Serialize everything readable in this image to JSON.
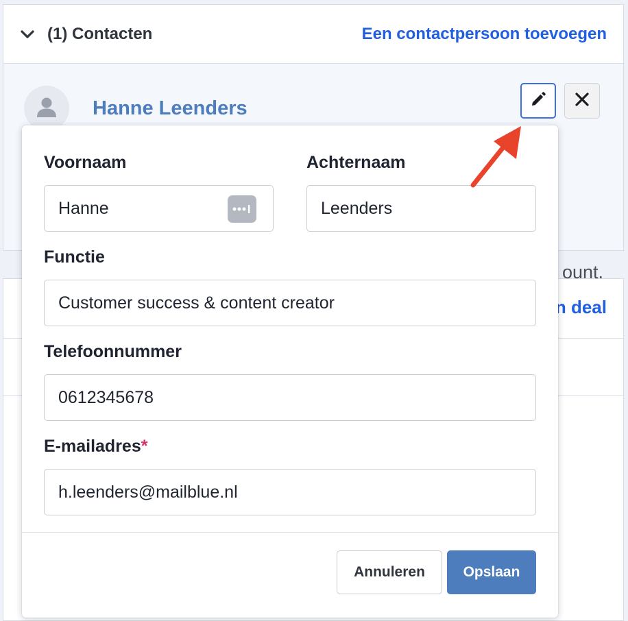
{
  "contacts_panel": {
    "title": "(1) Contacten",
    "add_link": "Een contactpersoon toevoegen",
    "icons": {
      "collapse": "chevron-down-icon",
      "avatar": "person-icon",
      "edit": "pencil-icon",
      "remove": "close-icon"
    }
  },
  "contact": {
    "name": "Hanne Leenders"
  },
  "deals_panel": {
    "add_link_partial": "n deal"
  },
  "background_text": "ount.",
  "edit_form": {
    "first_name": {
      "label": "Voornaam",
      "value": "Hanne"
    },
    "last_name": {
      "label": "Achternaam",
      "value": "Leenders"
    },
    "job_title": {
      "label": "Functie",
      "value": "Customer success & content creator"
    },
    "phone": {
      "label": "Telefoonnummer",
      "value": "0612345678"
    },
    "email": {
      "label": "E-mailadres",
      "required_mark": "*",
      "value": "h.leenders@mailblue.nl"
    },
    "cancel_label": "Annuleren",
    "save_label": "Opslaan"
  },
  "colors": {
    "link": "#1f5fe0",
    "name": "#4e7dbd",
    "primary_button": "#4e7dbd",
    "arrow": "#e8432b",
    "required": "#d6336c"
  }
}
